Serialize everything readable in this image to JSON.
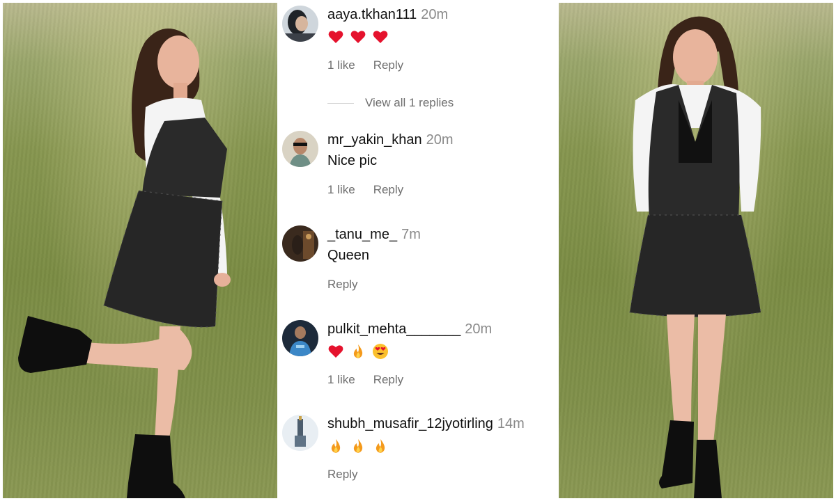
{
  "comments": [
    {
      "username": "aaya.tkhan111",
      "time": "20m",
      "text": "",
      "emojis": [
        "heart",
        "heart",
        "heart"
      ],
      "like_label": "1 like",
      "reply_label": "Reply",
      "view_replies": "View all 1 replies"
    },
    {
      "username": "mr_yakin_khan",
      "time": "20m",
      "text": "Nice pic",
      "emojis": [],
      "like_label": "1 like",
      "reply_label": "Reply"
    },
    {
      "username": "_tanu_me_",
      "time": "7m",
      "text": "Queen",
      "emojis": [],
      "like_label": "",
      "reply_label": "Reply"
    },
    {
      "username": "pulkit_mehta_______",
      "time": "20m",
      "text": "",
      "emojis": [
        "heart",
        "fire",
        "heart-eyes"
      ],
      "like_label": "1 like",
      "reply_label": "Reply"
    },
    {
      "username": "shubh_musafir_12jyotirling",
      "time": "14m",
      "text": "",
      "emojis": [
        "fire",
        "fire",
        "fire"
      ],
      "like_label": "",
      "reply_label": "Reply"
    }
  ],
  "icons": {
    "heart": "heart-emoji-icon",
    "fire": "fire-emoji-icon",
    "heart-eyes": "heart-eyes-emoji-icon"
  },
  "colors": {
    "username": "#111111",
    "timestamp": "#8a8a8a",
    "meta": "#6e6e6e",
    "heart": "#e5122d",
    "fire": "#f49a1c",
    "grass": "#7b8c44"
  }
}
